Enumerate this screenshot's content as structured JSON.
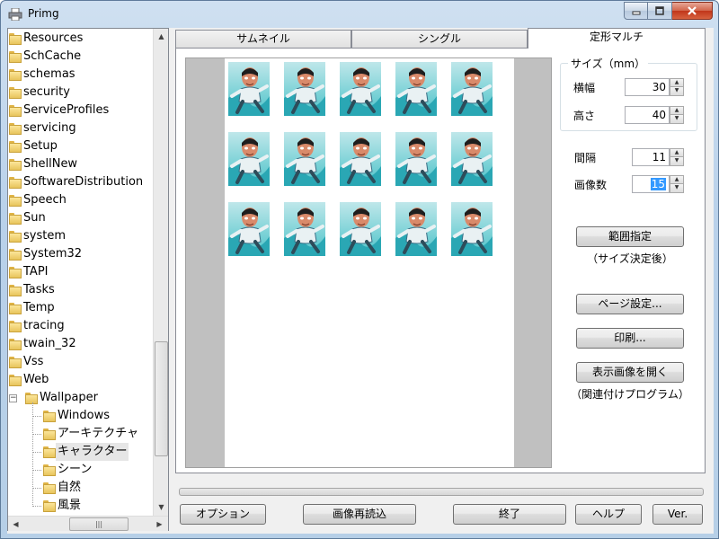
{
  "window": {
    "title": "Primg"
  },
  "colors": {
    "selection": "#3399ff",
    "progress_fill": "#06b025"
  },
  "tree": {
    "items": [
      {
        "label": "Resources",
        "level": 0
      },
      {
        "label": "SchCache",
        "level": 0
      },
      {
        "label": "schemas",
        "level": 0
      },
      {
        "label": "security",
        "level": 0
      },
      {
        "label": "ServiceProfiles",
        "level": 0
      },
      {
        "label": "servicing",
        "level": 0
      },
      {
        "label": "Setup",
        "level": 0
      },
      {
        "label": "ShellNew",
        "level": 0
      },
      {
        "label": "SoftwareDistribution",
        "level": 0
      },
      {
        "label": "Speech",
        "level": 0
      },
      {
        "label": "Sun",
        "level": 0
      },
      {
        "label": "system",
        "level": 0
      },
      {
        "label": "System32",
        "level": 0
      },
      {
        "label": "TAPI",
        "level": 0
      },
      {
        "label": "Tasks",
        "level": 0
      },
      {
        "label": "Temp",
        "level": 0
      },
      {
        "label": "tracing",
        "level": 0
      },
      {
        "label": "twain_32",
        "level": 0
      },
      {
        "label": "Vss",
        "level": 0
      },
      {
        "label": "Web",
        "level": 0
      },
      {
        "label": "Wallpaper",
        "level": 1,
        "expander": "−"
      },
      {
        "label": "Windows",
        "level": 2
      },
      {
        "label": "アーキテクチャ",
        "level": 2
      },
      {
        "label": "キャラクター",
        "level": 2,
        "selected": true
      },
      {
        "label": "シーン",
        "level": 2
      },
      {
        "label": "自然",
        "level": 2
      },
      {
        "label": "風景",
        "level": 2
      }
    ]
  },
  "tabs": [
    {
      "label": "サムネイル",
      "active": false
    },
    {
      "label": "シングル",
      "active": false
    },
    {
      "label": "定形マルチ",
      "active": true
    }
  ],
  "preview": {
    "rows": 3,
    "cols": 5,
    "image_count": 15
  },
  "size_group": {
    "legend": "サイズ（mm）",
    "width_label": "横幅",
    "width_value": "30",
    "height_label": "高さ",
    "height_value": "40"
  },
  "spacing": {
    "label": "間隔",
    "value": "11"
  },
  "image_count": {
    "label": "画像数",
    "value": "15"
  },
  "buttons": {
    "range": "範囲指定",
    "range_note": "（サイズ決定後）",
    "page_setup": "ページ設定...",
    "print": "印刷...",
    "open_image": "表示画像を開く",
    "open_note": "（関連付けプログラム）"
  },
  "progress": {
    "fraction": 0.0
  },
  "bottom_buttons": {
    "options": "オプション",
    "reload": "画像再読込",
    "exit": "終了",
    "help": "ヘルプ",
    "version": "Ver."
  },
  "icons": {
    "app": "printer-icon",
    "minimize": "minimize-icon",
    "maximize": "maximize-icon",
    "close": "close-icon",
    "folder": "folder-icon",
    "scroll_up": "scroll-up-icon",
    "scroll_down": "scroll-down-icon",
    "scroll_left": "scroll-left-icon",
    "scroll_right": "scroll-right-icon",
    "spin_up": "spin-up-icon",
    "spin_down": "spin-down-icon"
  }
}
